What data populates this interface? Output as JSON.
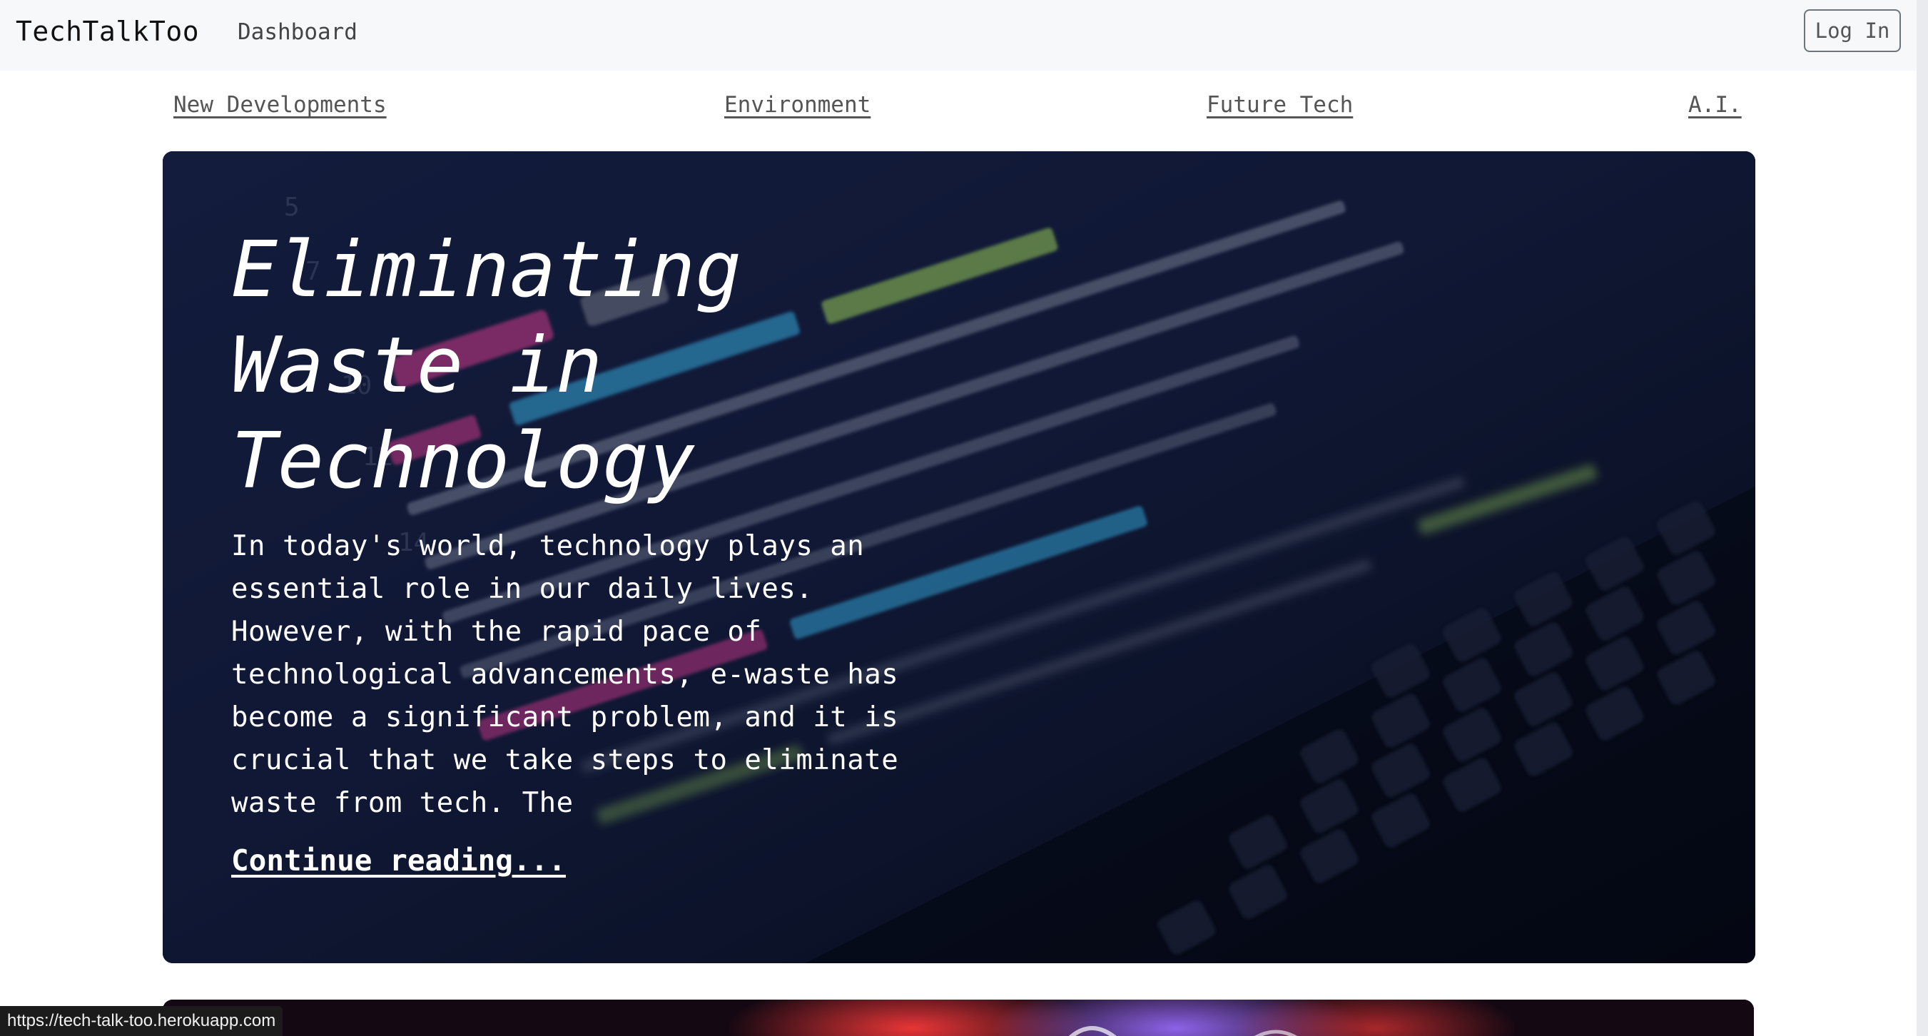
{
  "navbar": {
    "brand": "TechTalkToo",
    "dashboard_label": "Dashboard",
    "login_label": "Log In"
  },
  "categories": [
    {
      "label": "New Developments"
    },
    {
      "label": "Environment"
    },
    {
      "label": "Future Tech"
    },
    {
      "label": "A.I."
    }
  ],
  "featured_post": {
    "title": "Eliminating Waste in Technology",
    "excerpt": "In today's world, technology plays an essential role in our daily lives. However, with the rapid pace of technological advancements, e-waste has become a significant problem, and it is crucial that we take steps to eliminate waste from tech. The",
    "continue_label": "Continue reading..."
  },
  "status_bar": {
    "url": "https://tech-talk-too.herokuapp.com"
  },
  "colors": {
    "navbar_bg": "#f7f8f9",
    "hero_overlay": "#0d1430",
    "code_magenta": "#e8409a",
    "code_cyan": "#3ab8f0",
    "code_green": "#a8e060",
    "text_white": "#ffffff"
  }
}
